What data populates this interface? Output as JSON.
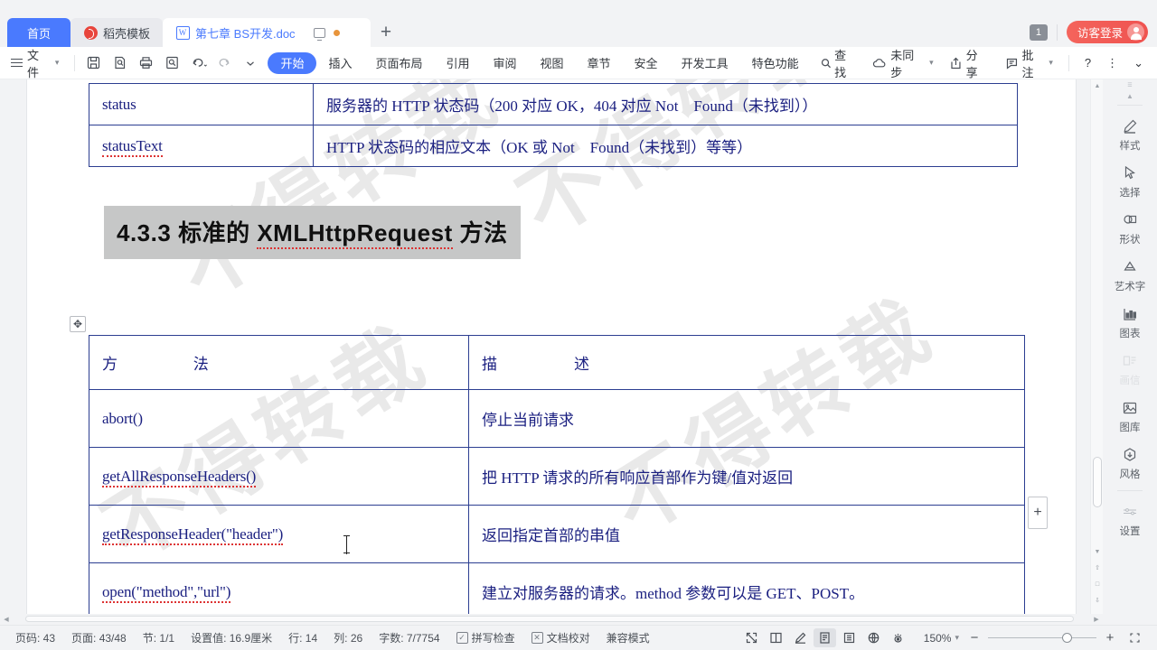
{
  "tabbar": {
    "tabs": [
      {
        "label": "首页",
        "icon": null,
        "kind": "home"
      },
      {
        "label": "稻壳模板",
        "icon": "docer-logo-icon",
        "kind": "template"
      },
      {
        "label": "第七章 BS开发.doc",
        "icon": "word-doc-icon",
        "kind": "doc"
      }
    ],
    "new_tab_label": "+",
    "presentation_icon": "screen-icon",
    "modified_dot": "unsaved-dot-icon",
    "count_badge": "1",
    "login_label": "访客登录",
    "login_avatar": "user-avatar-icon"
  },
  "toolbar": {
    "file_label": "文件",
    "quick_access": [
      {
        "name": "save-icon",
        "label": "保存"
      },
      {
        "name": "print-preview-icon",
        "label": "打印预览"
      },
      {
        "name": "print-icon",
        "label": "打印"
      },
      {
        "name": "find-replace-icon",
        "label": "查找替换"
      },
      {
        "name": "undo-icon",
        "label": "撤销"
      },
      {
        "name": "redo-icon",
        "label": "恢复"
      },
      {
        "name": "more-chevron-icon",
        "label": "更多"
      }
    ],
    "ribbon_tabs": [
      {
        "label": "开始",
        "active": true
      },
      {
        "label": "插入",
        "active": false
      },
      {
        "label": "页面布局",
        "active": false
      },
      {
        "label": "引用",
        "active": false
      },
      {
        "label": "审阅",
        "active": false
      },
      {
        "label": "视图",
        "active": false
      },
      {
        "label": "章节",
        "active": false
      },
      {
        "label": "安全",
        "active": false
      },
      {
        "label": "开发工具",
        "active": false
      },
      {
        "label": "特色功能",
        "active": false
      }
    ],
    "find_label": "查找",
    "right_items": [
      {
        "label": "未同步",
        "icon": "cloud-sync-icon",
        "caret": true
      },
      {
        "label": "分享",
        "icon": "share-icon",
        "caret": false
      },
      {
        "label": "批注",
        "icon": "comment-icon",
        "caret": true
      }
    ],
    "help_label": "?",
    "more_label": "⋮",
    "collapse_label": "⌄"
  },
  "document": {
    "watermark_text": "不得转载",
    "table1": {
      "rows": [
        {
          "name": "status",
          "desc": "服务器的 HTTP 状态码（200 对应 OK，404 对应 Not　Found（未找到））",
          "spell": false
        },
        {
          "name": "statusText",
          "desc": "HTTP 状态码的相应文本（OK 或 Not　Found（未找到）等等）",
          "spell": true
        }
      ]
    },
    "heading": {
      "number": "4.3.3",
      "text_before": "标准的",
      "emphasis": "XMLHttpRequest",
      "text_after": "方法",
      "full": "4.3.3 标准的 XMLHttpRequest 方法",
      "highlighted": true
    },
    "table2": {
      "headers": [
        "方　　　　　法",
        "描　　　　　述"
      ],
      "rows": [
        {
          "name": "abort()",
          "desc": "停止当前请求",
          "spell": false
        },
        {
          "name": "getAllResponseHeaders()",
          "desc": "把 HTTP 请求的所有响应首部作为键/值对返回",
          "spell": true
        },
        {
          "name": "getResponseHeader(\"header\")",
          "desc": "返回指定首部的串值",
          "spell": true
        },
        {
          "name": "open(\"method\",\"url\")",
          "desc": "建立对服务器的请求。method 参数可以是 GET、POST。",
          "spell": true
        }
      ]
    },
    "add_row_label": "+",
    "move_handle_icon": "table-move-handle-icon"
  },
  "right_sidebar": {
    "items": [
      {
        "label": "样式",
        "icon": "pen-style-icon",
        "dim": false
      },
      {
        "label": "选择",
        "icon": "cursor-select-icon",
        "dim": false
      },
      {
        "label": "形状",
        "icon": "shapes-icon",
        "dim": false
      },
      {
        "label": "艺术字",
        "icon": "wordart-icon",
        "dim": false
      },
      {
        "label": "图表",
        "icon": "chart-icon",
        "dim": false
      },
      {
        "label": "画信",
        "icon": "letter-icon",
        "dim": true
      },
      {
        "label": "图库",
        "icon": "gallery-icon",
        "dim": false
      },
      {
        "label": "风格",
        "icon": "style-badge-icon",
        "dim": false
      },
      {
        "label": "设置",
        "icon": "settings-icon",
        "dim": false
      }
    ]
  },
  "statusbar": {
    "items": [
      {
        "label": "页码: 43"
      },
      {
        "label": "页面: 43/48"
      },
      {
        "label": "节: 1/1"
      },
      {
        "label": "设置值: 16.9厘米"
      },
      {
        "label": "行: 14"
      },
      {
        "label": "列: 26"
      },
      {
        "label": "字数: 7/7754"
      }
    ],
    "spellcheck_label": "拼写检查",
    "spellcheck_icon": "check-box-icon",
    "proofread_label": "文档校对",
    "proofread_icon": "x-box-icon",
    "compat_label": "兼容模式",
    "view_buttons": [
      {
        "name": "fullscreen-icon",
        "active": false
      },
      {
        "name": "two-page-icon",
        "active": false
      },
      {
        "name": "edit-pen-icon",
        "active": false
      },
      {
        "name": "page-layout-view-icon",
        "active": true
      },
      {
        "name": "outline-view-icon",
        "active": false
      },
      {
        "name": "web-view-icon",
        "active": false
      },
      {
        "name": "eye-protect-icon",
        "active": false
      }
    ],
    "zoom_level": "150%",
    "zoom_out": "−",
    "zoom_in": "+",
    "fit_icon": "fit-screen-icon"
  }
}
